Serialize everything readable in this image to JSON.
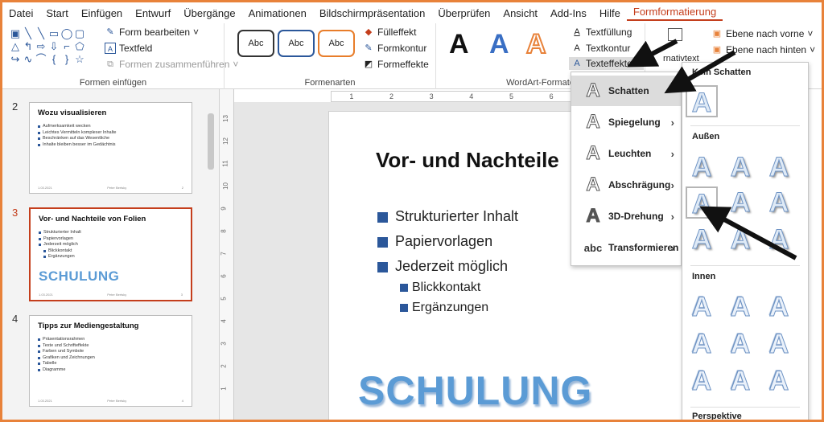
{
  "menu": [
    "Datei",
    "Start",
    "Einfügen",
    "Entwurf",
    "Übergänge",
    "Animationen",
    "Bildschirmpräsentation",
    "Überprüfen",
    "Ansicht",
    "Add-Ins",
    "Hilfe",
    "Formformatierung"
  ],
  "ribbon": {
    "form_bearbeiten": "Form bearbeiten",
    "textfeld": "Textfeld",
    "formen_zusammenfuehren": "Formen zusammenführen",
    "group_formen": "Formen einfügen",
    "style_label": "Abc",
    "group_formenarten": "Formenarten",
    "fuelleffekt": "Fülleffekt",
    "formkontur": "Formkontur",
    "formeffekte": "Formeffekte",
    "wordart_letter": "A",
    "group_wordart": "WordArt-Formate",
    "textfuellung": "Textfüllung",
    "textkontur": "Textkontur",
    "texteffekte": "Texteffekte",
    "alternativtext": "rnativtext",
    "ebene_vorne": "Ebene nach vorne",
    "ebene_hinten": "Ebene nach hinten"
  },
  "thumbs": [
    {
      "no": "2",
      "title": "Wozu visualisieren",
      "bullets": [
        "Aufmerksamkeit wecken",
        "Leichtes Vermitteln komplexer Inhalte",
        "Beschränken auf das Wesentliche",
        "Inhalte bleiben besser im Gedächtnis"
      ],
      "foot_l": "1.03.2021",
      "foot_m": "Peter Bertsky",
      "foot_r": "2"
    },
    {
      "no": "3",
      "title": "Vor- und Nachteile von Folien",
      "bullets": [
        "Strukturierter Inhalt",
        "Papiervorlagen",
        "Jederzeit möglich"
      ],
      "subs": [
        "Blickkontakt",
        "Ergänzungen"
      ],
      "logo": "SCHULUNG",
      "foot_l": "1.03.2021",
      "foot_m": "Peter Bertsky",
      "foot_r": "3"
    },
    {
      "no": "4",
      "title": "Tipps zur Mediengestaltung",
      "bullets": [
        "Präsentationsrahmen",
        "Texte und Schrifteffekte",
        "Farben und Symbole",
        "Grafiken und Zeichnungen",
        "Tabelle",
        "Diagramme"
      ],
      "foot_l": "1.03.2021",
      "foot_m": "Peter Bertsky",
      "foot_r": "4"
    }
  ],
  "slide": {
    "title": "Vor- und Nachteile",
    "bullets": [
      "Strukturierter Inhalt",
      "Papiervorlagen",
      "Jederzeit möglich"
    ],
    "subs": [
      "Blickkontakt",
      "Ergänzungen"
    ],
    "logo": "SCHULUNG"
  },
  "effects_menu": [
    "Schatten",
    "Spiegelung",
    "Leuchten",
    "Abschrägung",
    "3D-Drehung",
    "Transformieren"
  ],
  "gallery": {
    "kein_schatten": "Kein Schatten",
    "aussen": "Außen",
    "innen": "Innen",
    "perspektive": "Perspektive",
    "letter": "A"
  },
  "ruler_h": [
    "1",
    "2",
    "3",
    "4",
    "5",
    "6"
  ],
  "ruler_v": [
    "13",
    "12",
    "11",
    "10",
    "9",
    "8",
    "7",
    "6",
    "5",
    "4",
    "3",
    "2",
    "1"
  ],
  "colors": {
    "accent": "#c43e1c",
    "frame": "#e8823a",
    "bullet": "#2b579a",
    "logo": "#5b9bd5"
  }
}
